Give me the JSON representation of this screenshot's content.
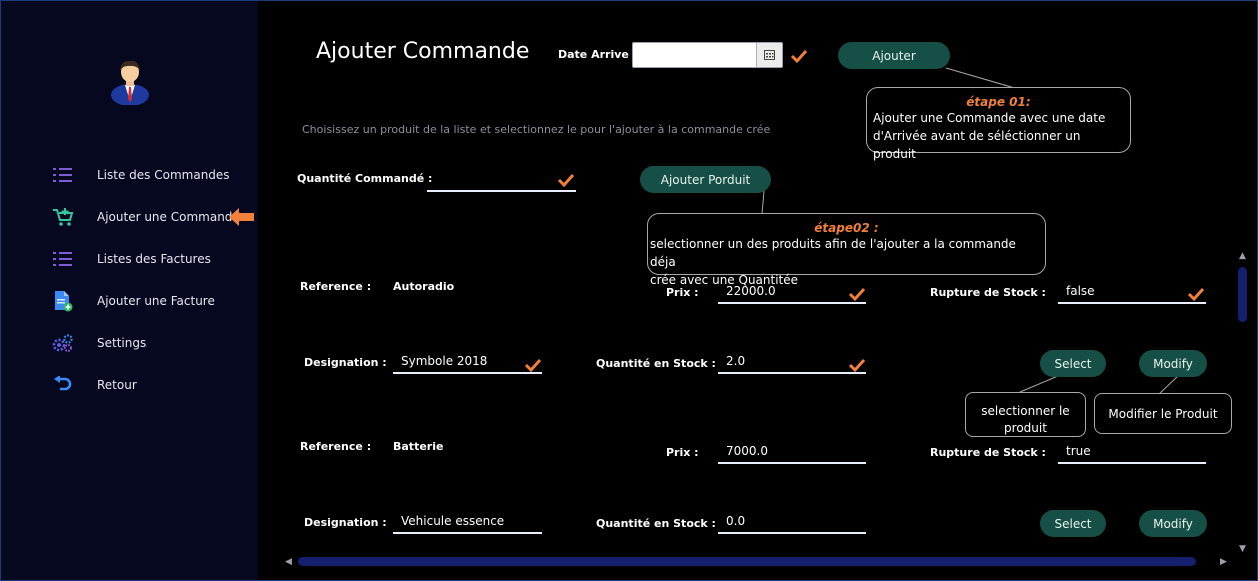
{
  "colors": {
    "sidebar_bg": "#05081f",
    "accent": "#f0803a",
    "button_bg": "#154f45",
    "scroll": "#14206e"
  },
  "sidebar": {
    "items": [
      {
        "label": "Liste des Commandes",
        "icon": "list-icon"
      },
      {
        "label": "Ajouter une Commande",
        "icon": "cart-add-icon"
      },
      {
        "label": "Listes des Factures",
        "icon": "list-icon"
      },
      {
        "label": "Ajouter une Facture",
        "icon": "document-add-icon"
      },
      {
        "label": "Settings",
        "icon": "cogs-icon"
      },
      {
        "label": "Retour",
        "icon": "return-icon"
      }
    ]
  },
  "header": {
    "title": "Ajouter Commande",
    "date_label": "Date Arrive :",
    "date_value": "",
    "add_button": "Ajouter"
  },
  "step1": {
    "title": "étape 01:",
    "text_line1": "Ajouter une Commande avec une date",
    "text_line2": "d'Arrivée avant de séléctionner un produit"
  },
  "hint": "Choisissez un produit de la liste et selectionnez le pour l'ajouter à la commande crée",
  "quantity": {
    "label": "Quantité Commandé :",
    "value": "",
    "add_product_button": "Ajouter Porduit"
  },
  "step2": {
    "title": "étape02 :",
    "text_line1": "selectionner un des produits afin de l'ajouter a la commande déja",
    "text_line2": "crée avec une Quantitée"
  },
  "labels": {
    "reference": "Reference :",
    "designation": "Designation :",
    "prix": "Prix :",
    "stock": "Quantité en Stock :",
    "rupture": "Rupture de Stock :",
    "select": "Select",
    "modify": "Modify"
  },
  "products": [
    {
      "reference": "Autoradio",
      "designation": "Symbole 2018",
      "prix": "22000.0",
      "stock": "2.0",
      "rupture": "false"
    },
    {
      "reference": "Batterie",
      "designation": "Vehicule essence",
      "prix": "7000.0",
      "stock": "0.0",
      "rupture": "true"
    }
  ],
  "callouts": {
    "select_line1": "selectionner le",
    "select_line2": "produit",
    "modify": "Modifier le Produit"
  }
}
